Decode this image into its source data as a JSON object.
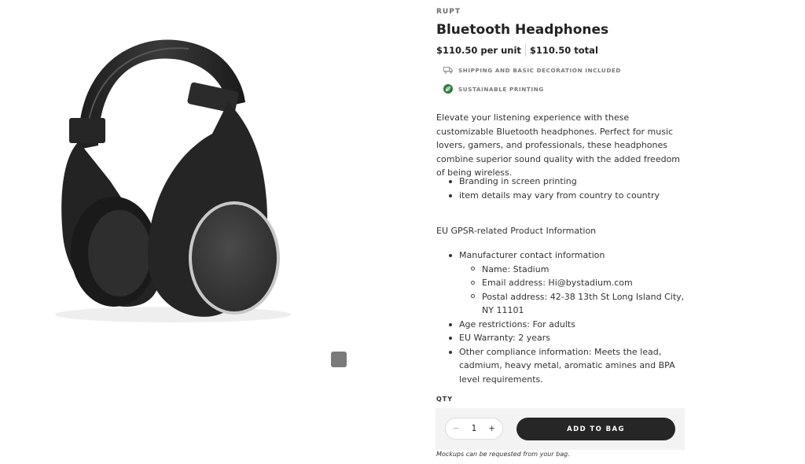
{
  "product": {
    "brand": "RUPT",
    "title": "Bluetooth Headphones",
    "price_unit": "$110.50 per unit",
    "price_total": "$110.50 total",
    "features": [
      {
        "icon": "truck-icon",
        "label": "SHIPPING AND BASIC DECORATION INCLUDED"
      },
      {
        "icon": "leaf-icon",
        "label": "SUSTAINABLE PRINTING"
      }
    ],
    "description": "Elevate your listening experience with these customizable Bluetooth headphones. Perfect for music lovers, gamers, and professionals, these headphones combine superior sound quality with the added freedom of being wireless.",
    "bullets": [
      "Branding in screen printing",
      "item details may vary from country to country"
    ]
  },
  "gpsr": {
    "title": "EU GPSR-related Product Information",
    "manufacturer_label": "Manufacturer contact information",
    "contact": [
      "Name: Stadium",
      "Email address: Hi@bystadium.com",
      "Postal address: 42-38 13th St Long Island City, NY 11101"
    ],
    "items": [
      "Age restrictions: For adults",
      "EU Warranty: 2 years",
      "Other compliance information: Meets the lead, cadmium, heavy metal, aromatic amines and BPA level requirements."
    ]
  },
  "purchase": {
    "qty_label": "QTY",
    "quantity": "1",
    "minus": "−",
    "plus": "+",
    "add_to_bag": "ADD TO BAG",
    "note": "Mockups can be requested from your bag."
  },
  "gallery": {
    "zoom_icon": "magnifier-icon"
  },
  "colors": {
    "button": "#262626",
    "leaf": "#2f7d3a",
    "box": "#f3f3f3"
  }
}
